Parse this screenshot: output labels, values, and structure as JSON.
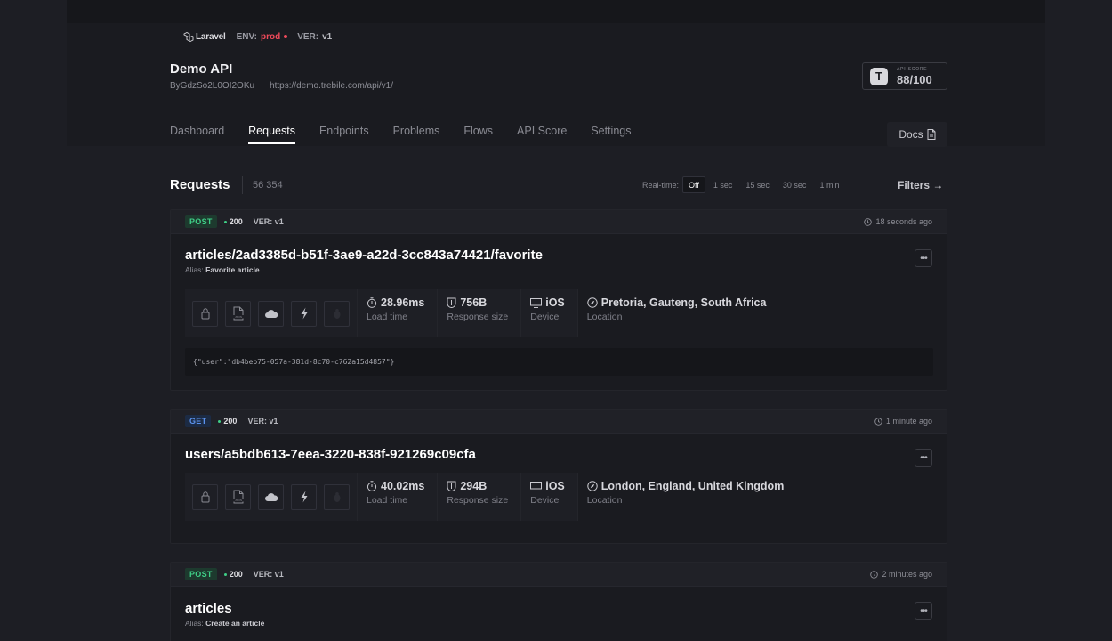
{
  "header": {
    "logo_text": "Laravel",
    "env_label": "ENV:",
    "env_value": "prod",
    "ver_label": "VER:",
    "ver_value": "v1",
    "title": "Demo API",
    "api_id": "ByGdzSo2L0OI2OKu",
    "api_url": "https://demo.trebile.com/api/v1/",
    "score_caption": "API SCORE",
    "score_value": "88/100"
  },
  "tabs": [
    {
      "label": "Dashboard",
      "active": false
    },
    {
      "label": "Requests",
      "active": true
    },
    {
      "label": "Endpoints",
      "active": false
    },
    {
      "label": "Problems",
      "active": false
    },
    {
      "label": "Flows",
      "active": false
    },
    {
      "label": "API Score",
      "active": false
    },
    {
      "label": "Settings",
      "active": false
    }
  ],
  "docs_label": "Docs",
  "requests": {
    "title": "Requests",
    "count": "56 354",
    "realtime_label": "Real-time:",
    "realtime_options": [
      "Off",
      "1 sec",
      "15 sec",
      "30 sec",
      "1 min"
    ],
    "realtime_selected": "Off",
    "filters_label": "Filters →"
  },
  "cards": [
    {
      "method": "POST",
      "status": "200",
      "ver": "VER: v1",
      "time": "18 seconds ago",
      "path": "articles/2ad3385d-b51f-3ae9-a22d-3cc843a74421/favorite",
      "alias_label": "Alias:",
      "alias": "Favorite article",
      "load_time": "28.96ms",
      "load_time_label": "Load time",
      "response_size": "756B",
      "response_size_label": "Response size",
      "device": "iOS",
      "device_label": "Device",
      "location": "Pretoria, Gauteng, South Africa",
      "location_label": "Location",
      "payload": "{\"user\":\"db4beb75-057a-381d-8c70-c762a15d4857\"}"
    },
    {
      "method": "GET",
      "status": "200",
      "ver": "VER: v1",
      "time": "1 minute ago",
      "path": "users/a5bdb613-7eea-3220-838f-921269c09cfa",
      "load_time": "40.02ms",
      "load_time_label": "Load time",
      "response_size": "294B",
      "response_size_label": "Response size",
      "device": "iOS",
      "device_label": "Device",
      "location": "London, England, United Kingdom",
      "location_label": "Location"
    },
    {
      "method": "POST",
      "status": "200",
      "ver": "VER: v1",
      "time": "2 minutes ago",
      "path": "articles",
      "alias_label": "Alias:",
      "alias": "Create an article"
    }
  ],
  "icons": {
    "lock": "lock-icon",
    "json": "json-file-icon",
    "cloud": "cloud-icon",
    "bolt": "lightning-icon",
    "bug": "bug-icon",
    "more": "more-dots-icon"
  },
  "colors": {
    "background": "#1d1e24",
    "post": "#3fcf87",
    "get": "#5b93ee",
    "env_prod": "#ef4a5a"
  }
}
